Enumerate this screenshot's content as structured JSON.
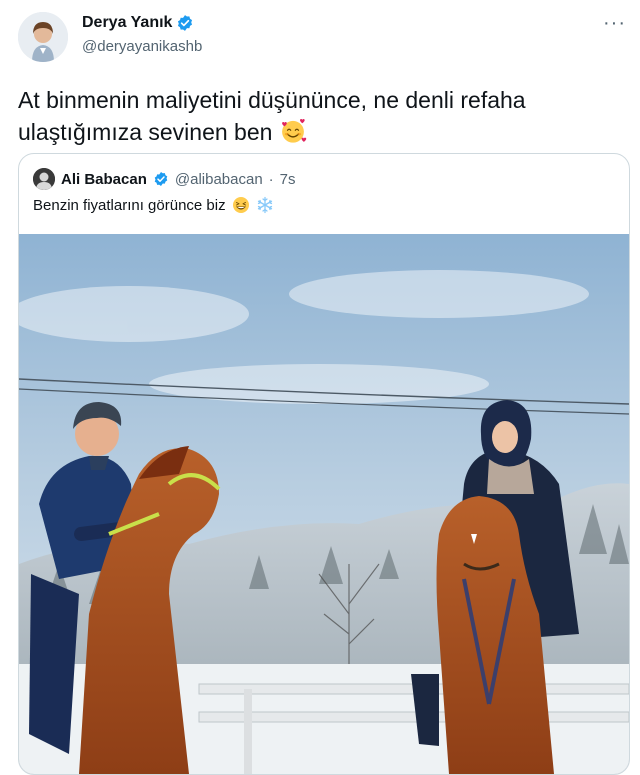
{
  "author": {
    "name": "Derya Yanık",
    "handle": "@deryayanikashb",
    "more_label": "···"
  },
  "tweet": {
    "text": "At binmenin maliyetini düşününce, ne denli refaha ulaştığımıza sevinen ben",
    "emoji": "smiling-face-with-hearts"
  },
  "quoted": {
    "name": "Ali Babacan",
    "handle": "@alibabacan",
    "separator": "·",
    "time": "7s",
    "text": "Benzin fiyatlarını görünce biz",
    "emojis": [
      "grinning-squinting-face",
      "snowflake"
    ]
  },
  "colors": {
    "verified": "#1d9bf0",
    "text": "#0f1419",
    "secondary": "#536471",
    "border": "#cfd9de"
  }
}
